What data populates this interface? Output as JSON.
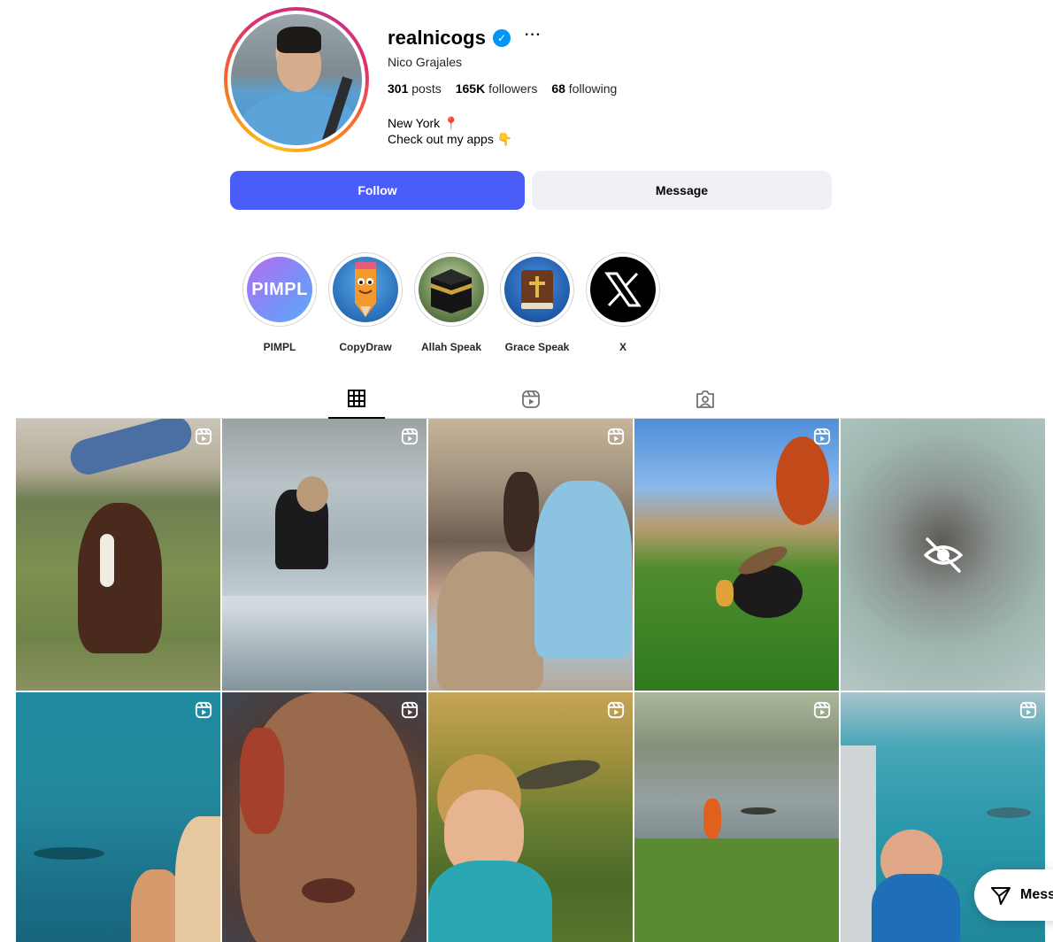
{
  "profile": {
    "username": "realnicogs",
    "verified_badge": "✓",
    "more_options": "···",
    "full_name": "Nico Grajales",
    "stats": {
      "posts_count": "301",
      "posts_label": "posts",
      "followers_count": "165K",
      "followers_label": "followers",
      "following_count": "68",
      "following_label": "following"
    },
    "bio_line1": "New York 📍",
    "bio_line2": "Check out my apps 👇"
  },
  "actions": {
    "follow_label": "Follow",
    "message_label": "Message"
  },
  "highlights": [
    {
      "label": "PIMPL",
      "cover_text": "PIMPL"
    },
    {
      "label": "CopyDraw"
    },
    {
      "label": "Allah Speak"
    },
    {
      "label": "Grace Speak"
    },
    {
      "label": "X"
    }
  ],
  "tabs": [
    {
      "name": "posts",
      "icon": "grid-icon",
      "active": true
    },
    {
      "name": "reels",
      "icon": "reels-icon",
      "active": false
    },
    {
      "name": "tagged",
      "icon": "tagged-icon",
      "active": false
    }
  ],
  "grid": {
    "columns": 5,
    "items": [
      {
        "type": "reel",
        "subject": "horse"
      },
      {
        "type": "reel",
        "subject": "glass-bridge"
      },
      {
        "type": "reel",
        "subject": "carriage-ride"
      },
      {
        "type": "reel",
        "subject": "child-with-hawk"
      },
      {
        "type": "hidden",
        "icon": "eye-slash-icon"
      },
      {
        "type": "reel",
        "subject": "shark-ocean"
      },
      {
        "type": "reel",
        "subject": "face-makeup"
      },
      {
        "type": "reel",
        "subject": "child-crocodile-grass"
      },
      {
        "type": "reel",
        "subject": "child-lake-alligator"
      },
      {
        "type": "reel",
        "subject": "child-boat-shark"
      }
    ]
  },
  "floating": {
    "messages_label": "Messages"
  },
  "colors": {
    "follow_button": "#4a5df9",
    "message_button": "#eff1f5",
    "verified": "#0095f6"
  }
}
